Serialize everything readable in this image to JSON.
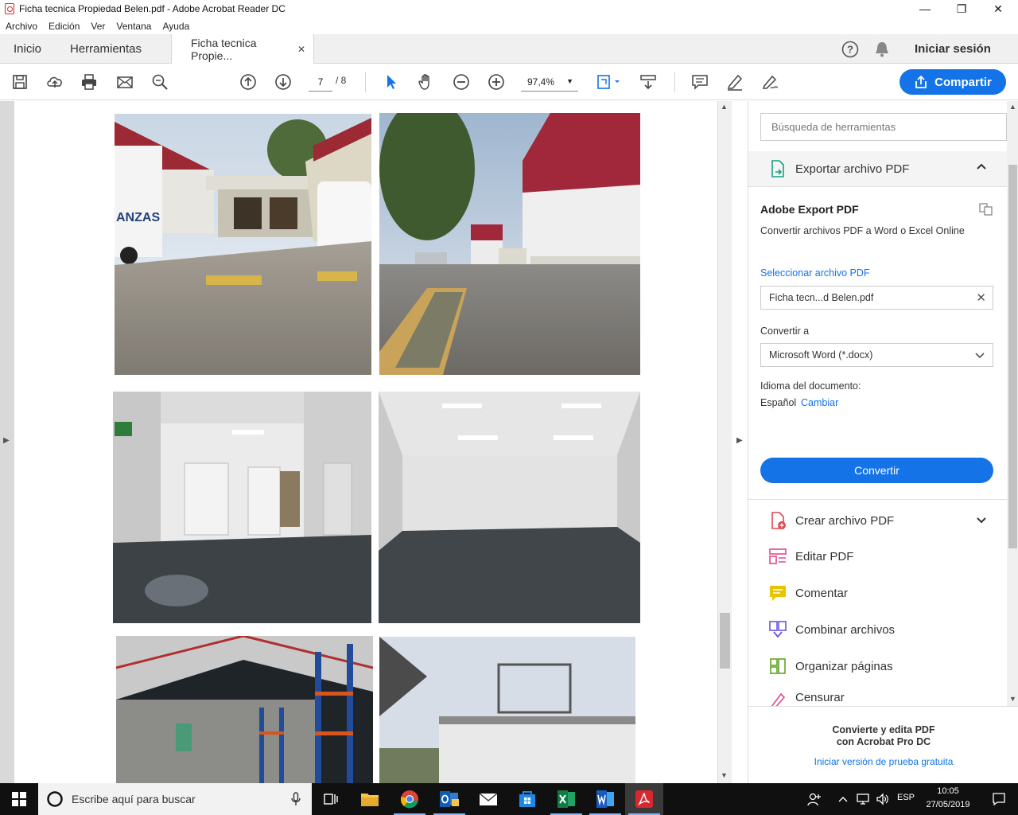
{
  "window": {
    "title": "Ficha tecnica Propiedad Belen.pdf - Adobe Acrobat Reader DC",
    "controls": {
      "minimize": "—",
      "restore": "❐",
      "close": "✕"
    }
  },
  "menu": [
    "Archivo",
    "Edición",
    "Ver",
    "Ventana",
    "Ayuda"
  ],
  "tabs": {
    "home": "Inicio",
    "tools": "Herramientas",
    "document": "Ficha tecnica Propie...",
    "close": "✕"
  },
  "header": {
    "signin": "Iniciar sesión"
  },
  "toolbar": {
    "page_current": "7",
    "page_total": "/ 8",
    "zoom": "97,4%",
    "share_label": "Compartir"
  },
  "document": {
    "photos": [
      {
        "subject": "truck loading area exterior"
      },
      {
        "subject": "warehouse exterior with driveway"
      },
      {
        "subject": "interior loading docks"
      },
      {
        "subject": "empty interior room"
      },
      {
        "subject": "warehouse racking interior"
      },
      {
        "subject": "exterior building with sign frame"
      }
    ]
  },
  "panel": {
    "search_placeholder": "Búsqueda de herramientas",
    "export_title": "Exportar archivo PDF",
    "adobe_export_title": "Adobe Export PDF",
    "adobe_export_desc": "Convertir archivos PDF a Word o Excel Online",
    "select_file_label": "Seleccionar archivo PDF",
    "selected_file": "Ficha tecn...d Belen.pdf",
    "convert_to_label": "Convertir a",
    "convert_to_value": "Microsoft Word (*.docx)",
    "language_label": "Idioma del documento:",
    "language_value": "Español",
    "language_change": "Cambiar",
    "convert_button": "Convertir",
    "tools": [
      {
        "label": "Crear archivo PDF",
        "icon": "create-pdf-icon",
        "color": "#e34850"
      },
      {
        "label": "Editar PDF",
        "icon": "edit-pdf-icon",
        "color": "#e34892"
      },
      {
        "label": "Comentar",
        "icon": "comment-icon",
        "color": "#e8c400"
      },
      {
        "label": "Combinar archivos",
        "icon": "combine-icon",
        "color": "#6d55e0"
      },
      {
        "label": "Organizar páginas",
        "icon": "organize-icon",
        "color": "#5fa324"
      },
      {
        "label": "Censurar",
        "icon": "redact-icon",
        "color": "#e34892"
      }
    ],
    "promo_line1": "Convierte y edita PDF",
    "promo_line2": "con Acrobat Pro DC",
    "promo_link": "Iniciar versión de prueba gratuita"
  },
  "taskbar": {
    "search_placeholder": "Escribe aquí para buscar",
    "language": "ESP",
    "time": "10:05",
    "date": "27/05/2019"
  },
  "colors": {
    "accent": "#1473e6",
    "acrobat_red": "#d7282f",
    "taskbar": "#101010"
  }
}
